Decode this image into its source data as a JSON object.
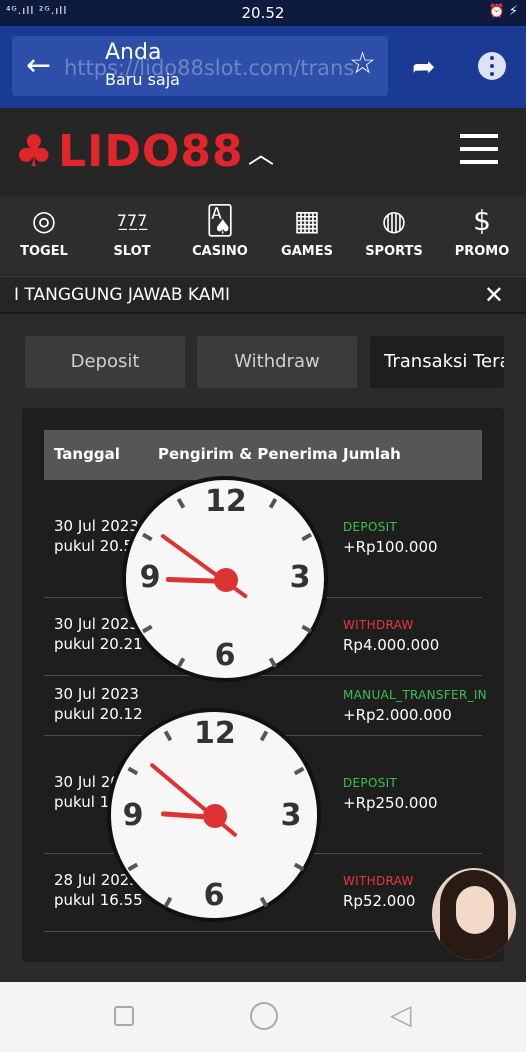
{
  "status": {
    "signal": "⁴ᴳ.ıll ²ᴳ.ıll",
    "time": "20.52",
    "icons": "⏰ ⚡"
  },
  "browser": {
    "url": "https://lido88slot.com/trans",
    "title": "Anda",
    "subtitle": "Baru saja"
  },
  "brand": {
    "name": "LIDO88",
    "color": "#e0252b"
  },
  "categories": [
    {
      "label": "TOGEL",
      "icon": "lottery-ball-icon",
      "glyph": "◎"
    },
    {
      "label": "SLOT",
      "icon": "slot-machine-icon",
      "glyph": "7̲7̲7̲"
    },
    {
      "label": "CASINO",
      "icon": "cards-dice-icon",
      "glyph": "🂡"
    },
    {
      "label": "GAMES",
      "icon": "arcade-icon",
      "glyph": "▦"
    },
    {
      "label": "SPORTS",
      "icon": "sports-ball-icon",
      "glyph": "◍"
    },
    {
      "label": "PROMO",
      "icon": "money-bag-icon",
      "glyph": "$"
    }
  ],
  "marquee": {
    "text": "I TANGGUNG JAWAB KAMI"
  },
  "tabs": [
    {
      "label": "Deposit"
    },
    {
      "label": "Withdraw"
    },
    {
      "label": "Transaksi Terakhir"
    }
  ],
  "table": {
    "headers": [
      "Tanggal",
      "Pengirim & Penerima",
      "Jumlah"
    ],
    "rows": [
      {
        "date": "30 Jul 2023",
        "time": "pukul 20.50",
        "type": "DEPOSIT",
        "amount": "+Rp100.000"
      },
      {
        "date": "30 Jul 2023",
        "time": "pukul 20.21",
        "type": "WITHDRAW",
        "amount": "Rp4.000.000"
      },
      {
        "date": "30 Jul 2023",
        "time": "pukul 20.12",
        "type": "MANUAL_TRANSFER_IN",
        "amount": "+Rp2.000.000"
      },
      {
        "date": "30 Jul 2023",
        "time": "pukul 18",
        "type": "DEPOSIT",
        "amount": "+Rp250.000"
      },
      {
        "date": "28 Jul 2023",
        "time": "pukul 16.55",
        "type": "WITHDRAW",
        "amount": "Rp52.000"
      }
    ]
  },
  "colors": {
    "deposit": "#3fbf4f",
    "withdraw": "#e23a3a"
  },
  "clock_numbers": [
    "12",
    "3",
    "6",
    "9"
  ]
}
